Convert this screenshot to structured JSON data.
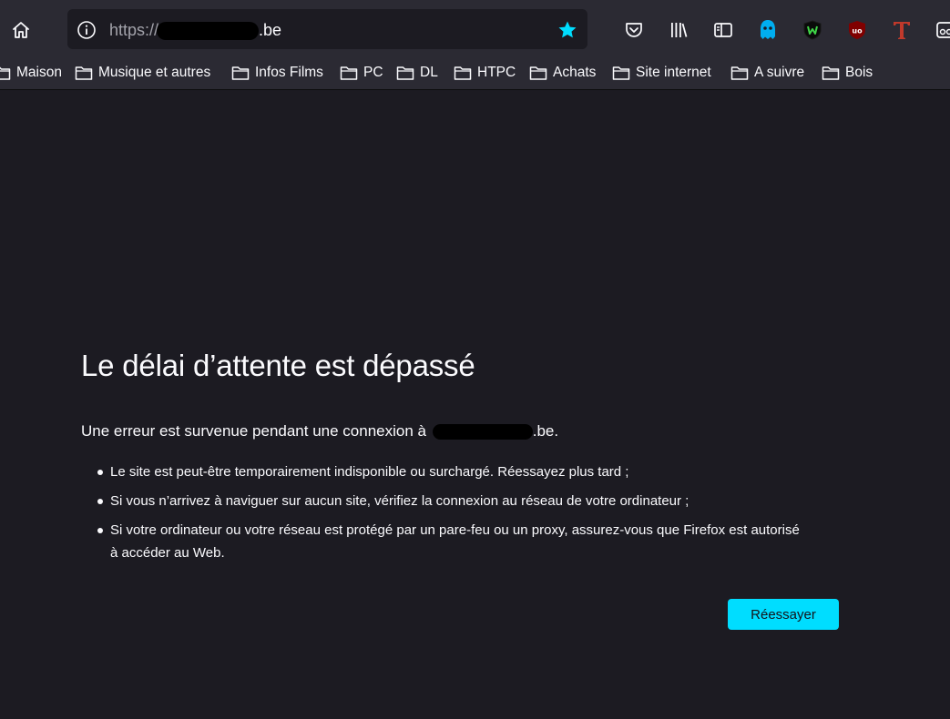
{
  "browser": {
    "url": {
      "scheme": "https://",
      "domain_suffix": ".be"
    }
  },
  "bookmarks": [
    {
      "label": "Maison"
    },
    {
      "label": "Musique et autres"
    },
    {
      "label": "Infos Films"
    },
    {
      "label": "PC"
    },
    {
      "label": "DL"
    },
    {
      "label": "HTPC"
    },
    {
      "label": "Achats"
    },
    {
      "label": "Site internet"
    },
    {
      "label": "A suivre"
    },
    {
      "label": "Bois"
    }
  ],
  "toolbar_icons": [
    "pocket-icon",
    "library-icon",
    "sidebar-icon",
    "ghostery-icon",
    "w-extension-icon",
    "ublock-origin-icon",
    "t-extension-icon",
    "extension-icon"
  ],
  "error": {
    "title": "Le délai d’attente est dépassé",
    "desc_prefix": "Une erreur est survenue pendant une connexion à ",
    "desc_suffix": ".be.",
    "items": [
      "Le site est peut-être temporairement indisponible ou surchargé. Réessayez plus tard ;",
      "Si vous n’arrivez à naviguer sur aucun site, vérifiez la connexion au réseau de votre ordinateur ;",
      "Si votre ordinateur ou votre réseau est protégé par un pare-feu ou un proxy, assurez-vous que Firefox est autorisé à accéder au Web."
    ],
    "retry_label": "Réessayer"
  },
  "colors": {
    "background": "#1c1b22",
    "toolbar": "#2b2a33",
    "accent": "#00ddff"
  }
}
